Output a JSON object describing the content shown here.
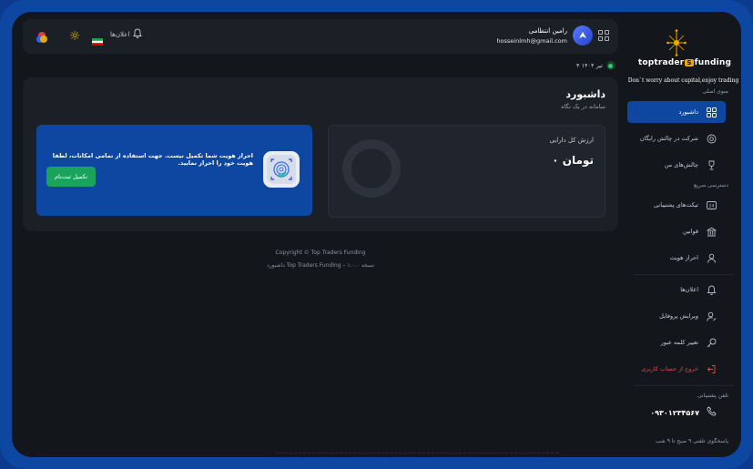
{
  "header": {
    "notifications_label": "اعلان‌ها",
    "user_name": "رامین انتظامی",
    "user_email": "hosseinlmh@gmail.com",
    "date": "۴ تیر ۱۴۰۴"
  },
  "dashboard": {
    "title": "داشبورد",
    "subtitle": "سامانه در یک نگاه",
    "asset_label": "ارزش کل دارایی",
    "asset_value": "۰ تومان",
    "kyc_message": "احراز هویت شما تکمیل نیست. جهت استفاده از تمامی امکانات، لطفا هویت خود را احراز نمایید.",
    "kyc_button": "تکمیل ثبت‌نام"
  },
  "footer": {
    "copyright": "Copyright © Top Traders Funding",
    "version": "داشبورد Top Traders Funding – نسخه ۱.۰.۰"
  },
  "sidebar": {
    "brand_left": "toptrader",
    "brand_badge": "S",
    "brand_right": "funding",
    "tagline": "Don`t worry about capital,enjoy trading",
    "main_menu_title": "منوی اصلی",
    "quick_access_title": "دسترسی سریع",
    "items": [
      {
        "label": "داشبورد",
        "icon": "grid-icon"
      },
      {
        "label": "شرکت در چالش رایگان",
        "icon": "target-icon"
      },
      {
        "label": "چالش‌های من",
        "icon": "trophy-icon"
      },
      {
        "label": "تیکت‌های پشتیبانی",
        "icon": "ticket-icon"
      },
      {
        "label": "قوانین",
        "icon": "bank-icon"
      },
      {
        "label": "احراز هویت",
        "icon": "user-icon"
      },
      {
        "label": "اعلان‌ها",
        "icon": "bell-icon"
      },
      {
        "label": "ویرایش پروفایل",
        "icon": "user-edit-icon"
      },
      {
        "label": "تغییر کلمه عبور",
        "icon": "key-icon"
      },
      {
        "label": "خروج از حساب کاربری",
        "icon": "logout-icon"
      }
    ],
    "support_phone_title": "تلفن پشتیبانی",
    "support_phone": "۰۹۳۰۱۲۳۴۵۶۷",
    "support_hours": "پاسخگوی تلفنی ۹ صبح تا ۹ شب"
  },
  "colors": {
    "accent": "#0d47a1",
    "success": "#1aa35a",
    "danger": "#e5484d",
    "background": "#13161b",
    "card": "#1b1f26"
  }
}
